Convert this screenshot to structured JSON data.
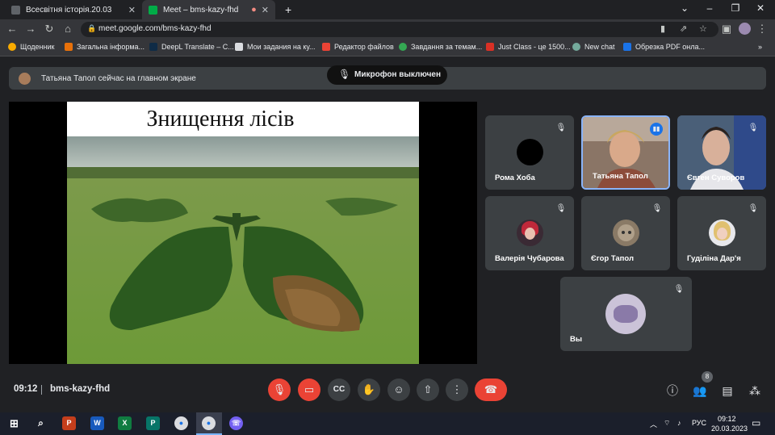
{
  "browser": {
    "tabs": [
      {
        "title": "Всесвітня історія.20.03",
        "active": false
      },
      {
        "title": "Meet – bms-kazy-fhd",
        "active": true
      }
    ],
    "new_tab": "+",
    "url": "meet.google.com/bms-kazy-fhd",
    "bookmarks": [
      "Щоденник",
      "Загальна інформа...",
      "DeepL Translate – С...",
      "Мои задания на ку...",
      "Редактор файлов",
      "Завдання за темам...",
      "Just Class - це 1500...",
      "New chat",
      "Обрезка PDF онла..."
    ]
  },
  "meet": {
    "presenter_notice": "Татьяна Тапол сейчас на главном экране",
    "mic_toast": "Микрофон выключен",
    "slide_title": "Знищення лісів",
    "participants": [
      {
        "name": "Рома Хоба"
      },
      {
        "name": "Татьяна Тапол"
      },
      {
        "name": "Євген Суворов"
      },
      {
        "name": "Валерія Чубарова"
      },
      {
        "name": "Єгор Тапол"
      },
      {
        "name": "Гуділіна Дар'я"
      },
      {
        "name": "Вы"
      }
    ],
    "time": "09:12",
    "meeting_code": "bms-kazy-fhd",
    "participants_count": "8"
  },
  "taskbar": {
    "language": "РУС",
    "time": "09:12",
    "date": "20.03.2023"
  },
  "colors": {
    "accent_red": "#ea4335",
    "speaking_blue": "#8ab4f8",
    "tile_bg": "#3c4043"
  }
}
